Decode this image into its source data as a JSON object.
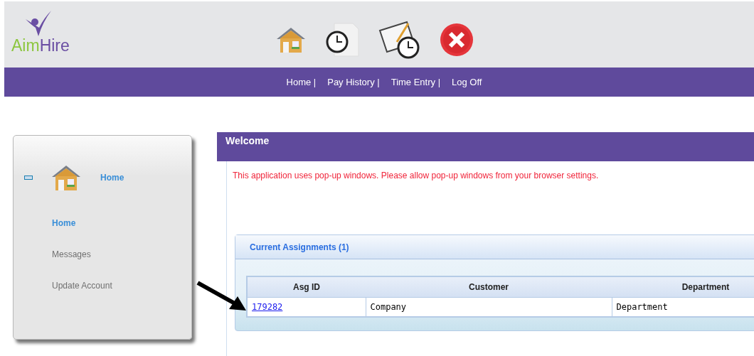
{
  "header": {
    "logo": {
      "part_1": "Aim",
      "part_2": "Hire"
    }
  },
  "nav": {
    "links": [
      "Home |",
      "Pay History |",
      "Time Entry |",
      "Log Off"
    ]
  },
  "sidebar": {
    "section": {
      "label": "Home",
      "expanded": true
    },
    "items": [
      {
        "label": "Home",
        "selected": true
      },
      {
        "label": "Messages",
        "selected": false
      },
      {
        "label": "Update Account",
        "selected": false
      }
    ]
  },
  "welcome": {
    "title": "Welcome",
    "notice": "This application uses pop-up windows. Please allow pop-up windows from your browser settings."
  },
  "assignments": {
    "title": "Current Assignments (1)",
    "columns": [
      "Asg ID",
      "Customer",
      "Department"
    ],
    "rows": [
      {
        "cells": [
          "179282",
          "Company",
          "Department"
        ]
      }
    ]
  }
}
